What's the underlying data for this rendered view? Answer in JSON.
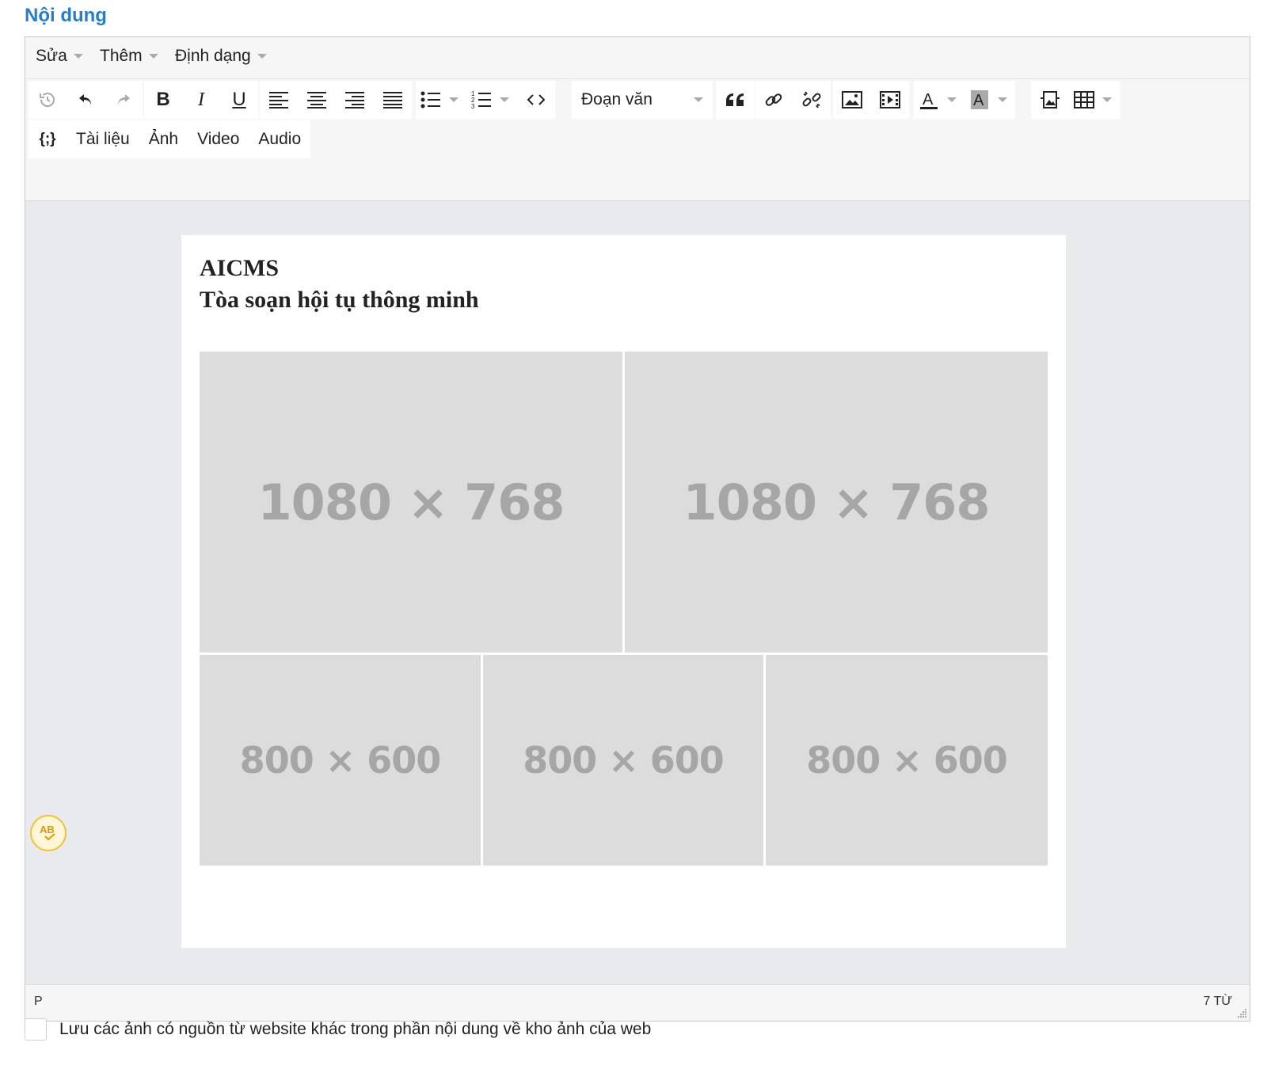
{
  "section": {
    "title": "Nội dung"
  },
  "menubar": {
    "items": [
      "Sửa",
      "Thêm",
      "Định dạng"
    ]
  },
  "toolbar": {
    "format_select": "Đoạn văn",
    "insert_buttons": [
      "Tài liệu",
      "Ảnh",
      "Video",
      "Audio"
    ]
  },
  "document": {
    "title_line1": "AICMS",
    "title_line2": "Tòa soạn hội tụ thông minh",
    "images": [
      {
        "label": "1080 × 768"
      },
      {
        "label": "1080 × 768"
      },
      {
        "label": "800 × 600"
      },
      {
        "label": "800 × 600"
      },
      {
        "label": "800 × 600"
      }
    ]
  },
  "statusbar": {
    "path": "P",
    "word_count": "7 TỪ"
  },
  "save_option": {
    "label": "Lưu các ảnh có nguồn từ website khác trong phần nội dung về kho ảnh của web",
    "checked": false
  },
  "colors": {
    "accent": "#2a7cc7",
    "placeholder_bg": "#dcdcdc",
    "editor_bg": "#e9eaee"
  }
}
